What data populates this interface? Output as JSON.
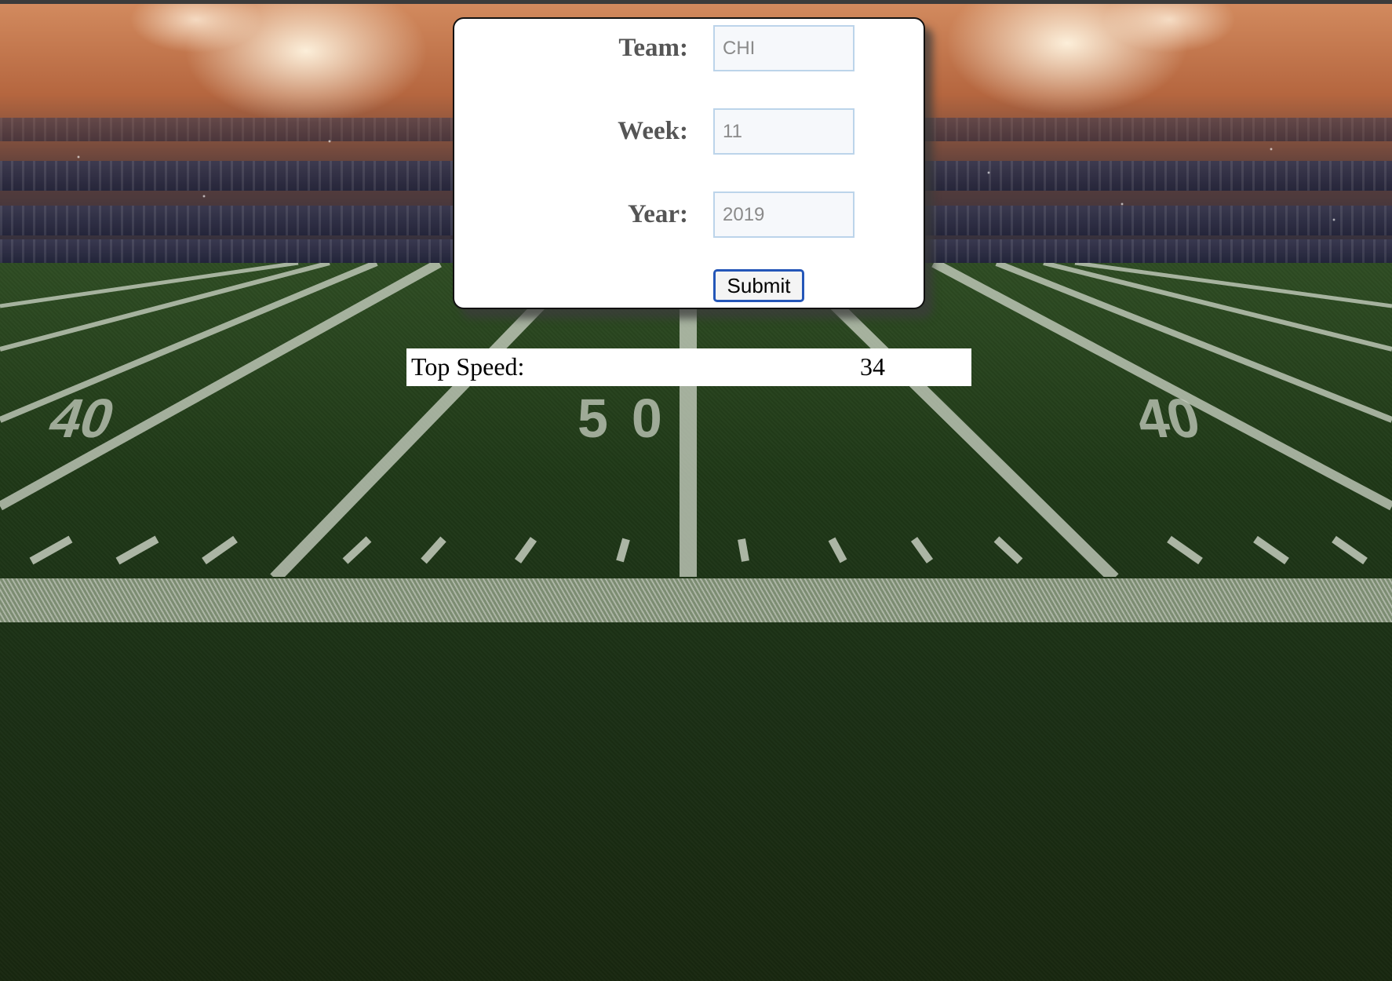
{
  "form": {
    "team": {
      "label": "Team:",
      "placeholder": "CHI"
    },
    "week": {
      "label": "Week:",
      "placeholder": "11"
    },
    "year": {
      "label": "Year:",
      "placeholder": "2019"
    },
    "submit_label": "Submit"
  },
  "result": {
    "label": "Top Speed:",
    "value": "34"
  },
  "field_markings": {
    "left_yardline": "40",
    "center_yardline": "50",
    "right_yardline": "40"
  }
}
